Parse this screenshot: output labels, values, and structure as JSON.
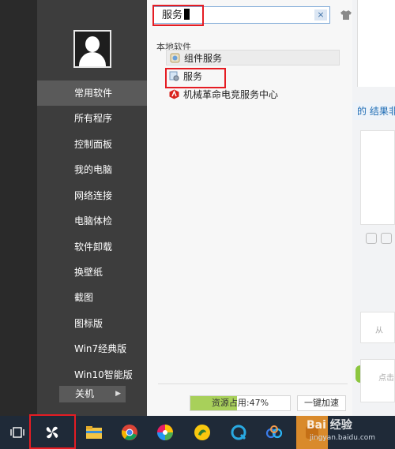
{
  "search": {
    "value": "服务",
    "clear_label": "×"
  },
  "section": {
    "label": "本地软件"
  },
  "results": [
    {
      "label": "组件服务",
      "icon": "component-services-icon"
    },
    {
      "label": "服务",
      "icon": "services-gear-icon"
    },
    {
      "label": "机械革命电竞服务中心",
      "icon": "mechrevo-icon"
    }
  ],
  "sidebar": {
    "items": [
      {
        "label": "常用软件",
        "active": true
      },
      {
        "label": "所有程序"
      },
      {
        "label": "控制面板"
      },
      {
        "label": "我的电脑"
      },
      {
        "label": "网络连接"
      },
      {
        "label": "电脑体检"
      },
      {
        "label": "软件卸载"
      },
      {
        "label": "换壁纸"
      },
      {
        "label": "截图"
      },
      {
        "label": "图标版"
      },
      {
        "label": "Win7经典版"
      },
      {
        "label": "Win10智能版"
      }
    ],
    "shutdown_label": "关机"
  },
  "footer": {
    "usage_label": "资源占用:47%",
    "usage_percent": 47,
    "speedup_label": "一键加速"
  },
  "background": {
    "strip_text": "的 结果非",
    "blk2_text": "从",
    "blk3_text": "点击"
  },
  "taskbar": {
    "items": [
      "task-view-icon",
      "start-fan-icon",
      "file-explorer-icon",
      "chrome-icon",
      "photos-icon",
      "cheetah-icon",
      "q-browser-icon",
      "baidu-netdisk-icon",
      "app-icon"
    ]
  },
  "watermark": {
    "main": "Bai 经验",
    "sub": "jingyan.baidu.com"
  },
  "colors": {
    "highlight_red": "#e51c23",
    "sidebar_bg": "#3d3d3d",
    "usage_fill": "#a8d05a",
    "taskbar_bg": "#1f2a38"
  }
}
